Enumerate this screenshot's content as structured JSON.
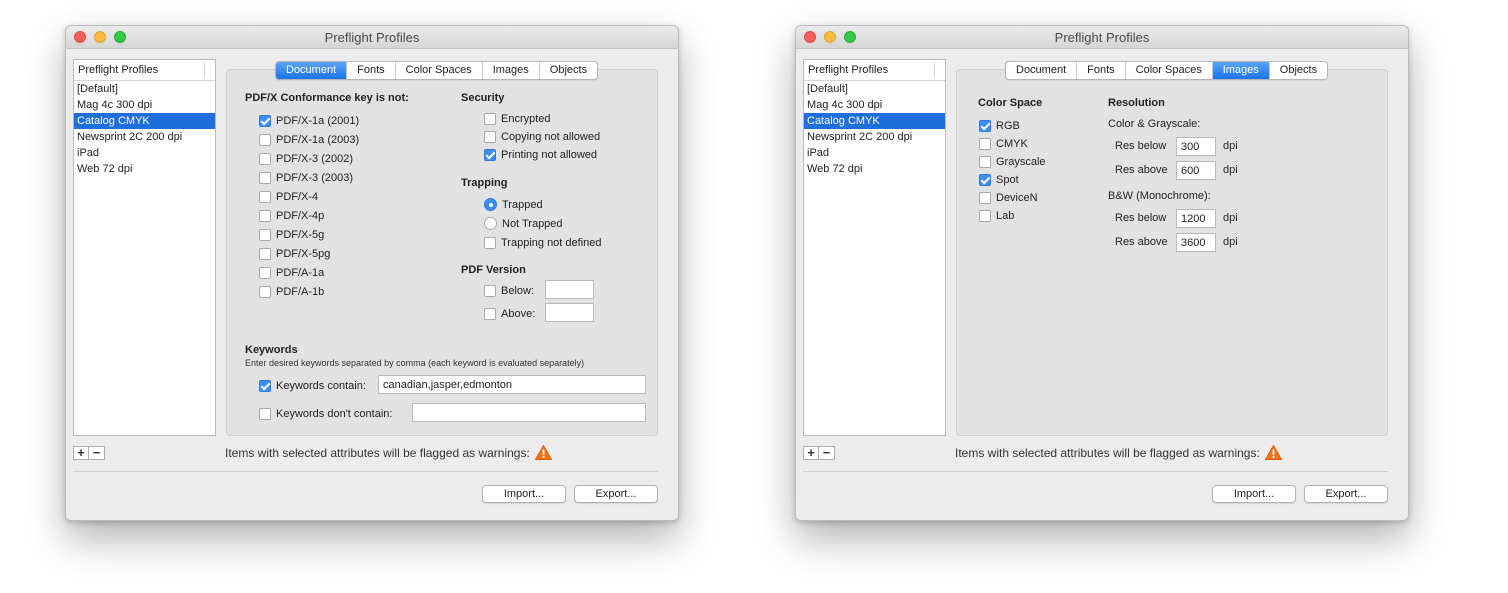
{
  "left_window": {
    "title": "Preflight Profiles",
    "profiles_header": "Preflight Profiles",
    "profiles": [
      "[Default]",
      "Mag 4c 300 dpi",
      "Catalog CMYK",
      "Newsprint 2C 200 dpi",
      "iPad",
      "Web 72 dpi"
    ],
    "selected_profile": "Catalog CMYK",
    "tabs": [
      "Document",
      "Fonts",
      "Color Spaces",
      "Images",
      "Objects"
    ],
    "active_tab": "Document",
    "conformance": {
      "heading": "PDF/X Conformance key is not:",
      "options": [
        {
          "label": "PDF/X-1a (2001)",
          "checked": true
        },
        {
          "label": "PDF/X-1a (2003)",
          "checked": false
        },
        {
          "label": "PDF/X-3 (2002)",
          "checked": false
        },
        {
          "label": "PDF/X-3 (2003)",
          "checked": false
        },
        {
          "label": "PDF/X-4",
          "checked": false
        },
        {
          "label": "PDF/X-4p",
          "checked": false
        },
        {
          "label": "PDF/X-5g",
          "checked": false
        },
        {
          "label": "PDF/X-5pg",
          "checked": false
        },
        {
          "label": "PDF/A-1a",
          "checked": false
        },
        {
          "label": "PDF/A-1b",
          "checked": false
        }
      ]
    },
    "security": {
      "heading": "Security",
      "options": [
        {
          "label": "Encrypted",
          "checked": false
        },
        {
          "label": "Copying not allowed",
          "checked": false
        },
        {
          "label": "Printing not allowed",
          "checked": true
        }
      ]
    },
    "trapping": {
      "heading": "Trapping",
      "trapped": {
        "label": "Trapped",
        "checked": true
      },
      "not_trapped": {
        "label": "Not Trapped",
        "checked": false
      },
      "not_defined": {
        "label": "Trapping not defined",
        "checked": false
      }
    },
    "pdf_version": {
      "heading": "PDF Version",
      "below": {
        "label": "Below:",
        "checked": false,
        "value": ""
      },
      "above": {
        "label": "Above:",
        "checked": false,
        "value": ""
      }
    },
    "keywords": {
      "heading": "Keywords",
      "note": "Enter desired keywords separated by comma (each keyword is evaluated separately)",
      "contain": {
        "label": "Keywords contain:",
        "checked": true,
        "value": "canadian,jasper,edmonton"
      },
      "not_contain": {
        "label": "Keywords don't contain:",
        "checked": false,
        "value": ""
      }
    },
    "warning_text": "Items with selected attributes will be flagged as warnings:",
    "import_label": "Import...",
    "export_label": "Export...",
    "add_label": "+",
    "remove_label": "−"
  },
  "right_window": {
    "title": "Preflight Profiles",
    "profiles_header": "Preflight Profiles",
    "profiles": [
      "[Default]",
      "Mag 4c 300 dpi",
      "Catalog CMYK",
      "Newsprint 2C 200 dpi",
      "iPad",
      "Web 72 dpi"
    ],
    "selected_profile": "Catalog CMYK",
    "tabs": [
      "Document",
      "Fonts",
      "Color Spaces",
      "Images",
      "Objects"
    ],
    "active_tab": "Images",
    "color_space": {
      "heading": "Color Space",
      "options": [
        {
          "label": "RGB",
          "checked": true
        },
        {
          "label": "CMYK",
          "checked": false
        },
        {
          "label": "Grayscale",
          "checked": false
        },
        {
          "label": "Spot",
          "checked": true
        },
        {
          "label": "DeviceN",
          "checked": false
        },
        {
          "label": "Lab",
          "checked": false
        }
      ]
    },
    "resolution": {
      "heading": "Resolution",
      "color_grayscale_label": "Color & Grayscale:",
      "cg_below_label": "Res below",
      "cg_below_value": "300",
      "cg_above_label": "Res above",
      "cg_above_value": "600",
      "bw_label": "B&W (Monochrome):",
      "bw_below_label": "Res below",
      "bw_below_value": "1200",
      "bw_above_label": "Res above",
      "bw_above_value": "3600",
      "unit": "dpi"
    },
    "warning_text": "Items with selected attributes will be flagged as warnings:",
    "import_label": "Import...",
    "export_label": "Export...",
    "add_label": "+",
    "remove_label": "−"
  },
  "colors": {
    "selection": "#1d6fde",
    "active_tab": "#1a72e8",
    "checkbox_checked": "#3b8ff6",
    "warning": "#f2731d",
    "close": "#fc605c",
    "minimize": "#fdbc40",
    "maximize": "#34c84a"
  },
  "icons": {
    "warning": "warning-triangle-icon",
    "checkbox": "checkbox-icon",
    "radio": "radio-button-icon"
  }
}
